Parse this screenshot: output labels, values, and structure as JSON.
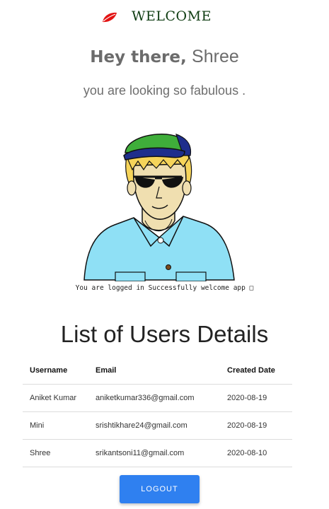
{
  "header": {
    "brand_icon": "leaf-icon",
    "brand_text": "WELCOME"
  },
  "greeting": {
    "prefix": "Hey there,",
    "name": "Shree"
  },
  "compliment": "you are looking so fabulous .",
  "avatar": {
    "icon": "cartoon-man-avatar"
  },
  "status_text": "You are logged in Successfully welcome app □",
  "users": {
    "title": "List of Users Details",
    "columns": [
      "Username",
      "Email",
      "Created Date"
    ],
    "rows": [
      [
        "Aniket Kumar",
        "aniketkumar336@gmail.com",
        "2020-08-19"
      ],
      [
        "Mini",
        "srishtikhare24@gmail.com",
        "2020-08-19"
      ],
      [
        "Shree",
        "srikantsoni11@gmail.com",
        "2020-08-10"
      ]
    ]
  },
  "logout_label": "LOGOUT",
  "colors": {
    "brand_leaf": "#e31313",
    "brand_text": "#0f3d12",
    "primary_button": "#2f80f0"
  }
}
